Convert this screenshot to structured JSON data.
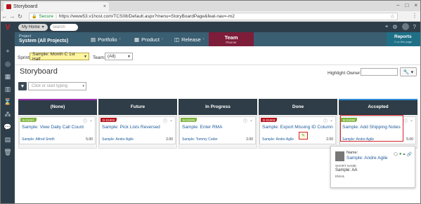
{
  "browser": {
    "tab_title": "Storyboard",
    "tab_close": "×",
    "url_secure": "Secure",
    "url": "https://www53.v1host.com/TCS08/Default.aspx?menu=StoryBoardPage&feat-nav=-m2",
    "window_controls": [
      "−",
      "□",
      "×"
    ]
  },
  "header": {
    "my_home": "My Home",
    "search_placeholder": "search"
  },
  "project": {
    "label": "Project",
    "value": "System (All Projects)"
  },
  "nav": {
    "portfolio": "Portfolio",
    "product": "Product",
    "release": "Release",
    "team": "Team",
    "team_sub": "Planner",
    "reports": "Reports",
    "reports_sub": "2 on this page"
  },
  "filters": {
    "sprint_label": "Sprint:",
    "sprint_value": "Sample: Month C 1st Half",
    "team_label": "Team:",
    "team_value": "(All)",
    "filter_placeholder": "Click or start typing"
  },
  "page_title": "Storyboard",
  "highlight_owner_label": "Highlight Owner:",
  "columns": [
    {
      "title": "(None)",
      "color": "#9b2fae"
    },
    {
      "title": "Future",
      "color": "#2e3d47"
    },
    {
      "title": "In Progress",
      "color": "#2e3d47"
    },
    {
      "title": "Done",
      "color": "#2e3d47"
    },
    {
      "title": "Accepted",
      "color": "#2e8ad6"
    }
  ],
  "cards": [
    {
      "id": "B-01021",
      "id_color": "#7db33a",
      "title": "Sample: View Daily Call Count",
      "owner": "Sample: Alfred Smith",
      "estimate": "5.00"
    },
    {
      "id": "D-01002",
      "id_color": "#b8131b",
      "title": "Sample: Pick Lists Reversed",
      "owner": "Sample: Andre Agile",
      "estimate": "2.00"
    },
    {
      "id": "B-01025",
      "id_color": "#7db33a",
      "title": "Sample: Enter RMA",
      "owner": "Sample: Tommy Coder",
      "estimate": "2.00"
    },
    {
      "id": "D-01003",
      "id_color": "#b8131b",
      "title": "Sample: Export Missing ID Column",
      "owner": "Sample: Andre Agile",
      "estimate": "2.00"
    },
    {
      "id": "B-01030",
      "id_color": "#7db33a",
      "title": "Sample: Add Shipping Notes",
      "owner": "Sample: Andre Agile",
      "estimate": "5.00"
    }
  ],
  "popup": {
    "name_label": "Name:",
    "name_value": "Sample: Andre Agile",
    "short_name_label": "SHORT NAME",
    "short_name_value": "Sample: AA",
    "email_label": "EMAIL"
  }
}
